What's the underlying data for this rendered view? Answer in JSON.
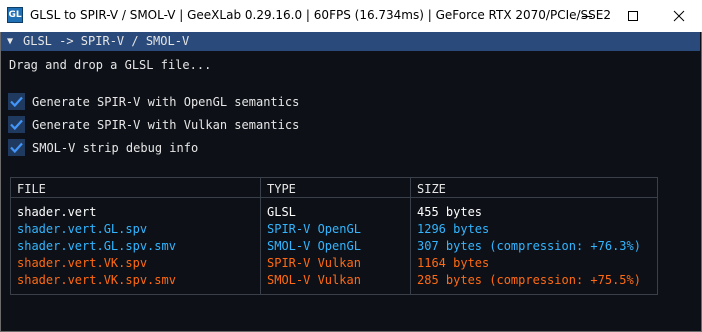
{
  "window": {
    "title": "GLSL to SPIR-V / SMOL-V | GeeXLab 0.29.16.0 | 60FPS (16.734ms) | GeForce RTX 2070/PCIe/SSE2",
    "icon": "geexlab-app-icon"
  },
  "panel": {
    "title": "GLSL -> SPIR-V / SMOL-V",
    "collapse_icon": "triangle-down-icon",
    "instruction": "Drag and drop a GLSL file..."
  },
  "checkboxes": [
    {
      "label": "Generate SPIR-V with OpenGL semantics",
      "checked": true
    },
    {
      "label": "Generate SPIR-V with Vulkan semantics",
      "checked": true
    },
    {
      "label": "SMOL-V strip debug info",
      "checked": true
    }
  ],
  "table": {
    "columns": [
      "FILE",
      "TYPE",
      "SIZE"
    ],
    "rows": [
      {
        "file": "shader.vert",
        "type": "GLSL",
        "size": "455 bytes",
        "color": "#ffffff"
      },
      {
        "file": "shader.vert.GL.spv",
        "type": "SPIR-V OpenGL",
        "size": "1296 bytes",
        "color": "#33b5ff"
      },
      {
        "file": "shader.vert.GL.spv.smv",
        "type": "SMOL-V OpenGL",
        "size": "307 bytes (compression: +76.3%)",
        "color": "#33b5ff"
      },
      {
        "file": "shader.vert.VK.spv",
        "type": "SPIR-V Vulkan",
        "size": "1164 bytes",
        "color": "#ff6a14"
      },
      {
        "file": "shader.vert.VK.spv.smv",
        "type": "SMOL-V Vulkan",
        "size": "285 bytes (compression: +75.5%)",
        "color": "#ff6a14"
      }
    ]
  },
  "colors": {
    "background": "#0d1117",
    "header": "#294a7a",
    "checkbox_bg": "#203a5f",
    "checkmark": "#4296fa",
    "opengl": "#33b5ff",
    "vulkan": "#ff6a14"
  }
}
